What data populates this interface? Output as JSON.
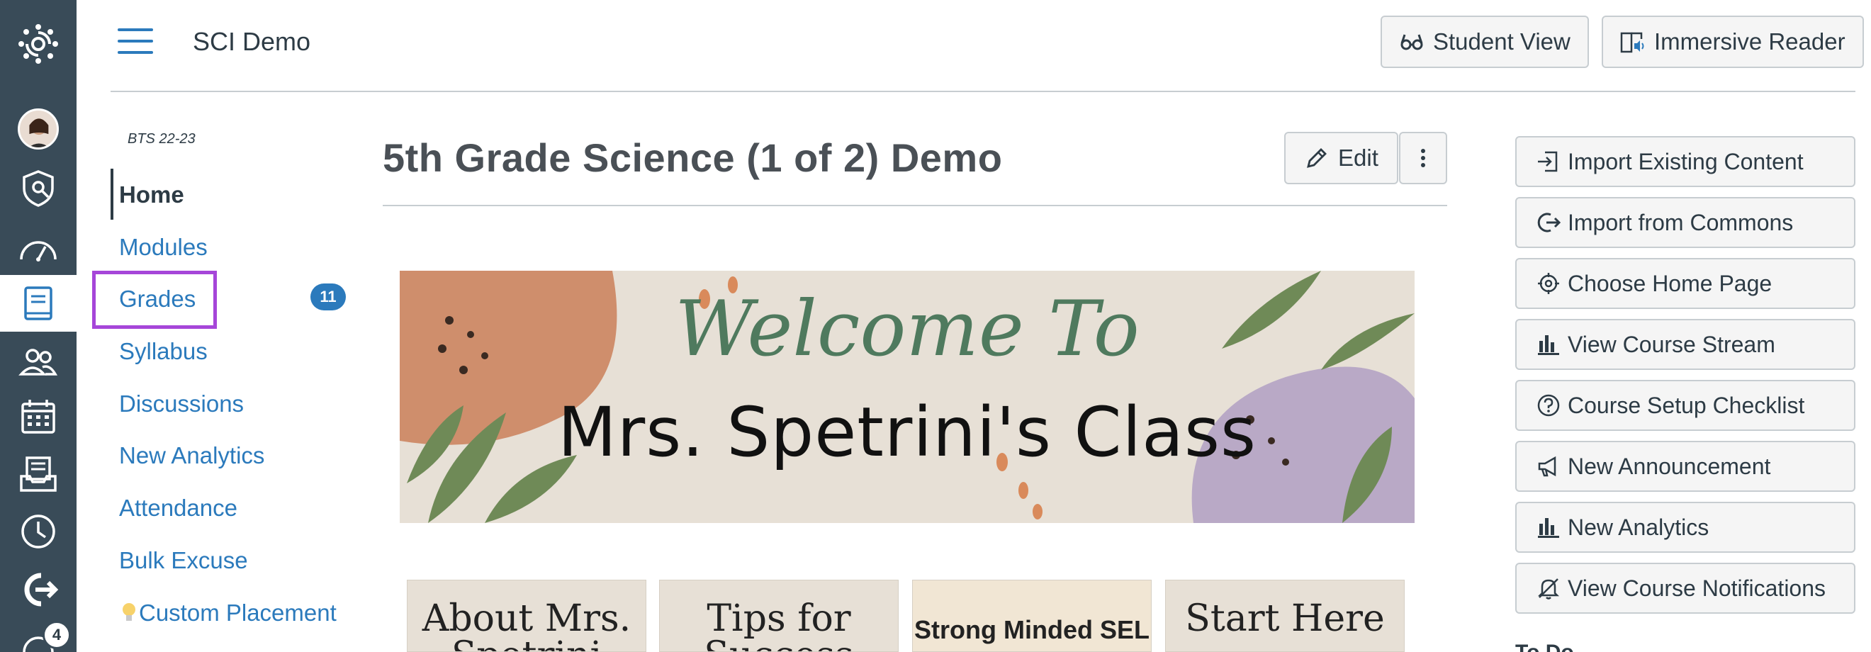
{
  "global_nav": {
    "items": [
      {
        "name": "logo-icon"
      },
      {
        "name": "account-avatar"
      },
      {
        "name": "admin-icon"
      },
      {
        "name": "dashboard-icon"
      },
      {
        "name": "courses-icon"
      },
      {
        "name": "groups-icon"
      },
      {
        "name": "calendar-icon"
      },
      {
        "name": "inbox-icon"
      },
      {
        "name": "history-icon"
      },
      {
        "name": "commons-icon"
      },
      {
        "name": "help-icon"
      }
    ],
    "help_badge": "4"
  },
  "header": {
    "course_name": "SCI Demo",
    "student_view_label": "Student View",
    "immersive_reader_label": "Immersive Reader"
  },
  "course_nav": {
    "term": "BTS 22-23",
    "items": [
      {
        "label": "Home"
      },
      {
        "label": "Modules"
      },
      {
        "label": "Grades",
        "badge": "11"
      },
      {
        "label": "Syllabus"
      },
      {
        "label": "Discussions"
      },
      {
        "label": "New Analytics"
      },
      {
        "label": "Attendance"
      },
      {
        "label": "Bulk Excuse"
      },
      {
        "label": "Custom Placement"
      }
    ]
  },
  "main": {
    "title": "5th Grade Science (1 of 2) Demo",
    "edit_label": "Edit",
    "banner": {
      "script_text": "Welcome To",
      "main_text": "Mrs. Spetrini's Class"
    },
    "tiles": [
      {
        "label": "About Mrs. Spetrini"
      },
      {
        "label": "Tips for Success"
      },
      {
        "label": "Strong Minded SEL"
      },
      {
        "label": "Start Here"
      }
    ]
  },
  "sidebar": {
    "buttons": [
      {
        "label": "Import Existing Content",
        "icon": "import-icon"
      },
      {
        "label": "Import from Commons",
        "icon": "commons-icon"
      },
      {
        "label": "Choose Home Page",
        "icon": "target-icon"
      },
      {
        "label": "View Course Stream",
        "icon": "bar-chart-icon"
      },
      {
        "label": "Course Setup Checklist",
        "icon": "question-icon"
      },
      {
        "label": "New Announcement",
        "icon": "megaphone-icon"
      },
      {
        "label": "New Analytics",
        "icon": "bar-chart-icon"
      },
      {
        "label": "View Course Notifications",
        "icon": "bell-icon"
      }
    ],
    "todo_title": "To Do"
  },
  "colors": {
    "nav_bg": "#394b58",
    "link": "#2b7abc",
    "highlight": "#a646d9"
  }
}
